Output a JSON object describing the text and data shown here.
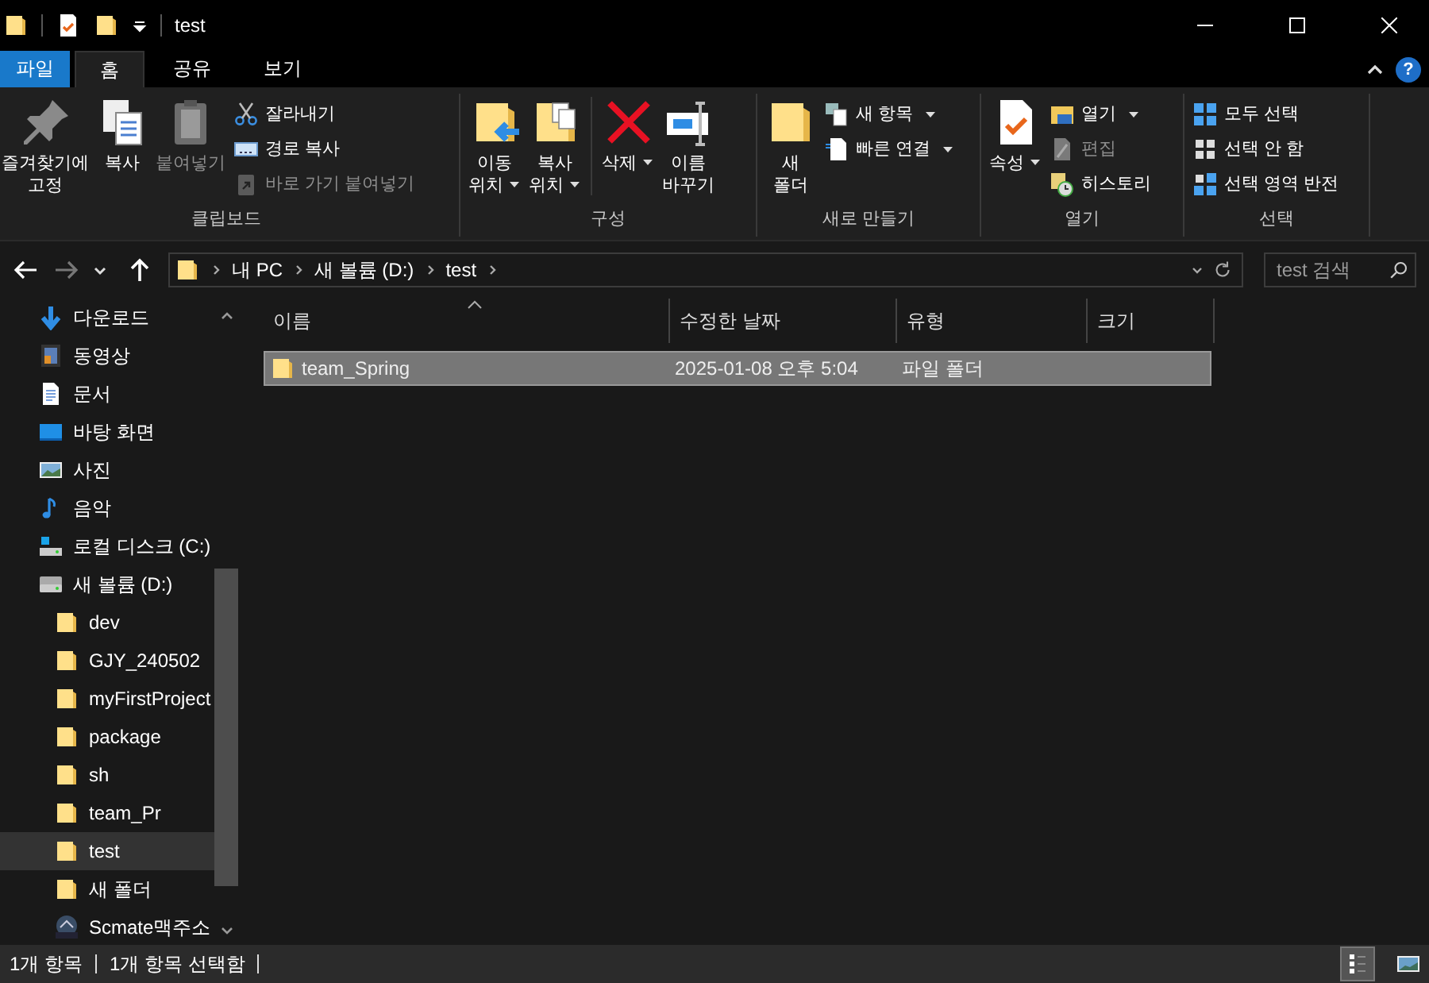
{
  "window": {
    "title": "test"
  },
  "ribbon": {
    "tabs": [
      {
        "label": "파일",
        "kind": "file",
        "selected": false
      },
      {
        "label": "홈",
        "kind": "tab",
        "selected": true
      },
      {
        "label": "공유",
        "kind": "tab",
        "selected": false
      },
      {
        "label": "보기",
        "kind": "tab",
        "selected": false
      }
    ],
    "help": "?",
    "groups": [
      {
        "label": "클립보드",
        "items": [
          {
            "kind": "large",
            "label": "즐겨찾기에\n고정",
            "disabled": false,
            "dropdown": false
          },
          {
            "kind": "large",
            "label": "복사",
            "disabled": false,
            "dropdown": false
          },
          {
            "kind": "large",
            "label": "붙여넣기",
            "disabled": true,
            "dropdown": false
          },
          {
            "kind": "small",
            "label": "잘라내기",
            "disabled": false,
            "dropdown": false
          },
          {
            "kind": "small",
            "label": "경로 복사",
            "disabled": false,
            "dropdown": false
          },
          {
            "kind": "small",
            "label": "바로 가기 붙여넣기",
            "disabled": true,
            "dropdown": false
          }
        ]
      },
      {
        "label": "구성",
        "items": [
          {
            "kind": "large",
            "label": "이동\n위치",
            "disabled": false,
            "dropdown": true
          },
          {
            "kind": "large",
            "label": "복사\n위치",
            "disabled": false,
            "dropdown": true
          },
          {
            "kind": "separator"
          },
          {
            "kind": "large",
            "label": "삭제",
            "disabled": false,
            "dropdown": true
          },
          {
            "kind": "large",
            "label": "이름\n바꾸기",
            "disabled": false,
            "dropdown": false
          }
        ]
      },
      {
        "label": "새로 만들기",
        "items": [
          {
            "kind": "large",
            "label": "새\n폴더",
            "disabled": false,
            "dropdown": false
          },
          {
            "kind": "small",
            "label": "새 항목",
            "disabled": false,
            "dropdown": true
          },
          {
            "kind": "small",
            "label": "빠른 연결",
            "disabled": false,
            "dropdown": true
          }
        ]
      },
      {
        "label": "열기",
        "items": [
          {
            "kind": "large",
            "label": "속성",
            "disabled": false,
            "dropdown": true
          },
          {
            "kind": "small",
            "label": "열기",
            "disabled": false,
            "dropdown": true
          },
          {
            "kind": "small",
            "label": "편집",
            "disabled": true,
            "dropdown": false
          },
          {
            "kind": "small",
            "label": "히스토리",
            "disabled": false,
            "dropdown": false
          }
        ]
      },
      {
        "label": "선택",
        "items": [
          {
            "kind": "small",
            "label": "모두 선택",
            "disabled": false,
            "dropdown": false
          },
          {
            "kind": "small",
            "label": "선택 안 함",
            "disabled": false,
            "dropdown": false
          },
          {
            "kind": "small",
            "label": "선택 영역 반전",
            "disabled": false,
            "dropdown": false
          }
        ]
      }
    ]
  },
  "navigation": {
    "back": {
      "disabled": false
    },
    "forward": {
      "disabled": true
    }
  },
  "address": {
    "breadcrumbs": [
      "내 PC",
      "새 볼륨 (D:)",
      "test"
    ]
  },
  "search": {
    "placeholder": "test 검색"
  },
  "sidebar": {
    "items": [
      {
        "label": "다운로드",
        "selected": false
      },
      {
        "label": "동영상",
        "selected": false
      },
      {
        "label": "문서",
        "selected": false
      },
      {
        "label": "바탕 화면",
        "selected": false
      },
      {
        "label": "사진",
        "selected": false
      },
      {
        "label": "음악",
        "selected": false
      },
      {
        "label": "로컬 디스크 (C:)",
        "selected": false
      },
      {
        "label": "새 볼륨 (D:)",
        "selected": false,
        "children": [
          {
            "label": "dev",
            "kind": "folder",
            "selected": false
          },
          {
            "label": "GJY_240502",
            "kind": "folder",
            "selected": false
          },
          {
            "label": "myFirstProject",
            "kind": "folder",
            "selected": false
          },
          {
            "label": "package",
            "kind": "folder",
            "selected": false
          },
          {
            "label": "sh",
            "kind": "folder",
            "selected": false
          },
          {
            "label": "team_Pr",
            "kind": "folder",
            "selected": false
          },
          {
            "label": "test",
            "kind": "folder",
            "selected": true
          },
          {
            "label": "새 폴더",
            "kind": "folder",
            "selected": false
          },
          {
            "label": "Scmate맥주소",
            "kind": "archive",
            "selected": false
          }
        ]
      }
    ]
  },
  "table": {
    "columns": [
      {
        "label": "이름",
        "sorted": true
      },
      {
        "label": "수정한 날짜",
        "sorted": false
      },
      {
        "label": "유형",
        "sorted": false
      },
      {
        "label": "크기",
        "sorted": false
      }
    ],
    "rows": [
      {
        "name": "team_Spring",
        "modified": "2025-01-08 오후 5:04",
        "type": "파일 폴더",
        "selected": true
      }
    ]
  },
  "status_bar": {
    "items": "1개 항목",
    "selection": "1개 항목 선택함"
  },
  "views": [
    {
      "selected": true
    },
    {
      "selected": false
    }
  ]
}
